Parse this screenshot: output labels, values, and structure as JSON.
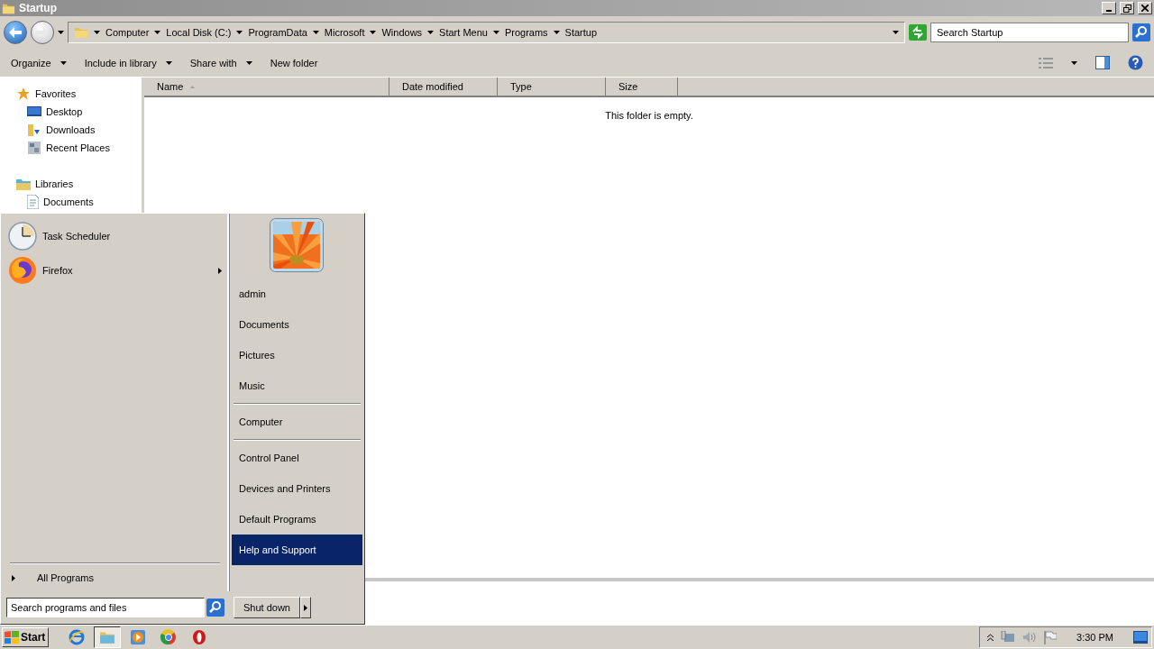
{
  "window": {
    "title": "Startup"
  },
  "breadcrumbs": [
    "Computer",
    "Local Disk (C:)",
    "ProgramData",
    "Microsoft",
    "Windows",
    "Start Menu",
    "Programs",
    "Startup"
  ],
  "search": {
    "placeholder": "Search Startup"
  },
  "commands": [
    {
      "label": "Organize",
      "has_menu": true
    },
    {
      "label": "Include in library",
      "has_menu": true
    },
    {
      "label": "Share with",
      "has_menu": true
    },
    {
      "label": "New folder",
      "has_menu": false
    }
  ],
  "nav": [
    {
      "label": "Favorites",
      "children": [
        {
          "label": "Desktop"
        },
        {
          "label": "Downloads"
        },
        {
          "label": "Recent Places"
        }
      ]
    },
    {
      "label": "Libraries",
      "children": [
        {
          "label": "Documents"
        }
      ]
    }
  ],
  "columns": [
    {
      "label": "Name",
      "sorted": true
    },
    {
      "label": "Date modified",
      "sorted": false
    },
    {
      "label": "Type",
      "sorted": false
    },
    {
      "label": "Size",
      "sorted": false
    }
  ],
  "empty_message": "This folder is empty.",
  "start_menu": {
    "pinned": [
      {
        "label": "Task Scheduler",
        "submenu": false
      },
      {
        "label": "Firefox",
        "submenu": true
      }
    ],
    "all_programs": "All Programs",
    "search": {
      "placeholder": "Search programs and files"
    },
    "place_groups": [
      {
        "items": [
          {
            "label": "admin",
            "selected": false
          },
          {
            "label": "Documents",
            "selected": false
          },
          {
            "label": "Pictures",
            "selected": false
          },
          {
            "label": "Music",
            "selected": false
          }
        ]
      },
      {
        "items": [
          {
            "label": "Computer",
            "selected": false
          }
        ]
      },
      {
        "items": [
          {
            "label": "Control Panel",
            "selected": false
          },
          {
            "label": "Devices and Printers",
            "selected": false
          },
          {
            "label": "Default Programs",
            "selected": false
          },
          {
            "label": "Help and Support",
            "selected": true
          }
        ]
      }
    ],
    "shutdown": "Shut down"
  },
  "taskbar": {
    "start": "Start",
    "apps": [
      {
        "active": false
      },
      {
        "active": true
      },
      {
        "active": false
      },
      {
        "active": false
      },
      {
        "active": false
      }
    ],
    "time": "3:30 PM"
  }
}
